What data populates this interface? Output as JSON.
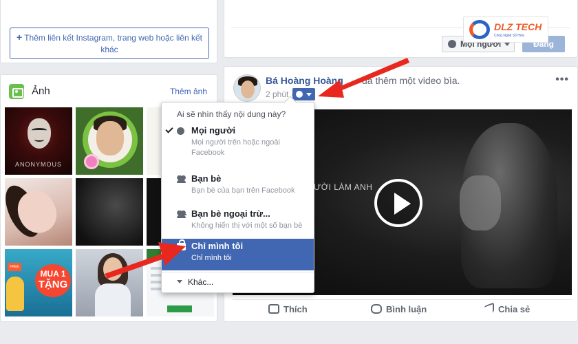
{
  "left_top": {
    "add_link_label": "Thêm liên kết Instagram, trang web hoặc liên kết khác"
  },
  "photos": {
    "title": "Ảnh",
    "add_label": "Thêm ảnh",
    "thumb1_caption": "ANONYMOUS",
    "thumb7_badge_line1": "MUA 1",
    "thumb7_badge_line2": "TẶNG",
    "thumb7_free": "FREE"
  },
  "composer": {
    "audience_label": "Mọi người",
    "post_label": "Đăng"
  },
  "logo": {
    "name": "DLZ TECH",
    "tagline": "Công Nghệ Số Hóa"
  },
  "post": {
    "author": "Bá Hoàng Hoàng",
    "action": "đã thêm một video bìa.",
    "time": "2 phút ·",
    "video_caption": "ƯỜI LÀM ANH",
    "actions": {
      "like": "Thích",
      "comment": "Bình luận",
      "share": "Chia sẻ"
    }
  },
  "privacy_menu": {
    "header": "Ai sẽ nhìn thấy nội dung này?",
    "items": [
      {
        "title": "Mọi người",
        "desc": "Mọi người trên hoặc ngoài Facebook",
        "icon": "globe-icon",
        "checked": true
      },
      {
        "title": "Bạn bè",
        "desc": "Bạn bè của bạn trên Facebook",
        "icon": "friends-icon"
      },
      {
        "title": "Bạn bè ngoại trừ...",
        "desc": "Không hiển thị với một số bạn bè",
        "icon": "friends-except-icon"
      },
      {
        "title": "Chỉ mình tôi",
        "desc": "Chỉ mình tôi",
        "icon": "lock-icon",
        "highlighted": true
      }
    ],
    "more_label": "Khác..."
  },
  "colors": {
    "facebook_blue": "#4267b2",
    "link_blue": "#365899",
    "arrow_red": "#e8281e",
    "page_bg": "#e9ebee"
  }
}
